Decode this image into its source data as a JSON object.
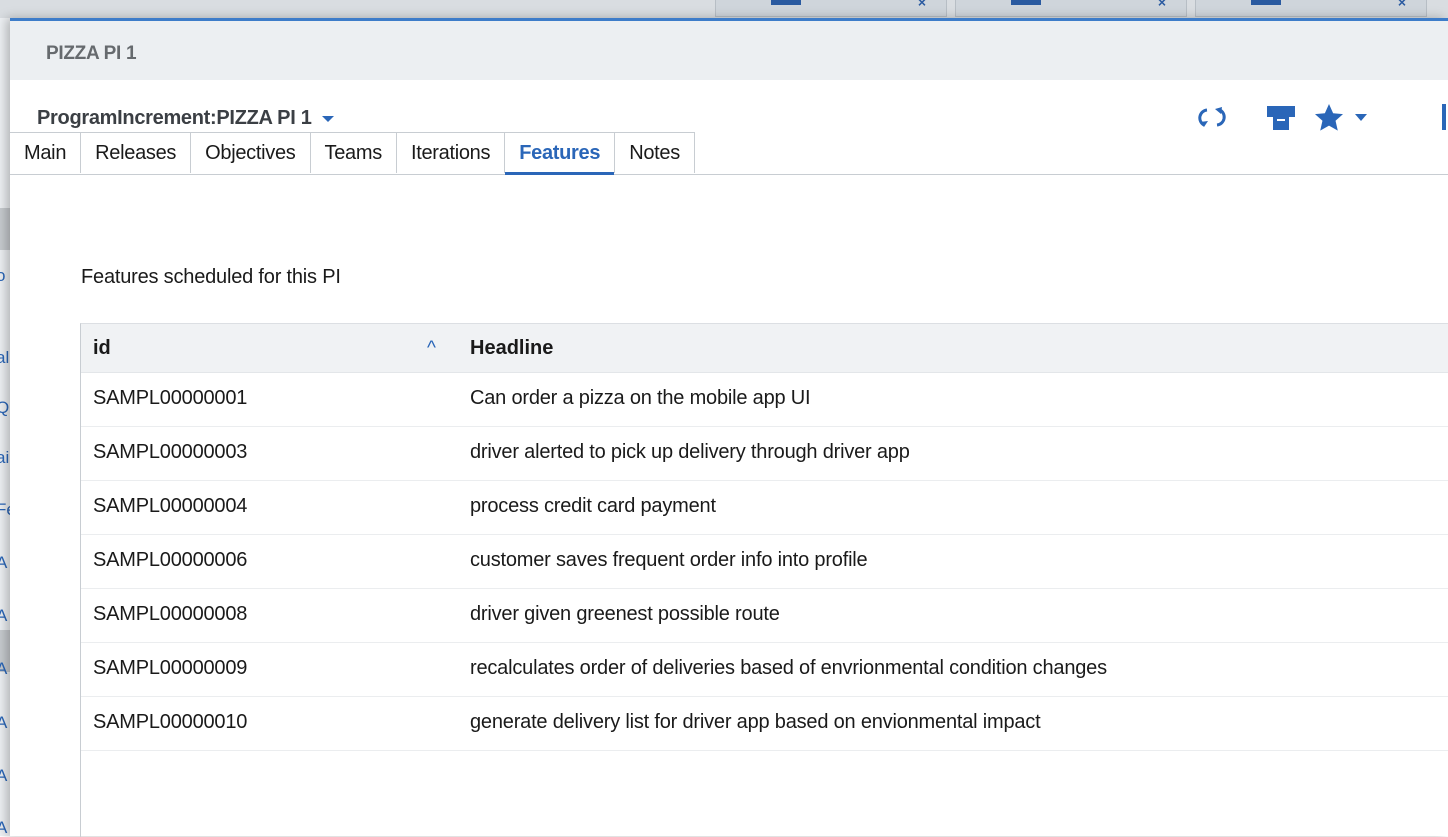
{
  "window": {
    "title": "PIZZA PI 1"
  },
  "header": {
    "record_title": "ProgramIncrement:PIZZA PI 1"
  },
  "toolbar": {
    "icons": [
      "refresh-icon",
      "print-icon",
      "star-icon",
      "chevron-down-icon"
    ]
  },
  "tabs": [
    {
      "label": "Main",
      "active": false
    },
    {
      "label": "Releases",
      "active": false
    },
    {
      "label": "Objectives",
      "active": false
    },
    {
      "label": "Teams",
      "active": false
    },
    {
      "label": "Iterations",
      "active": false
    },
    {
      "label": "Features",
      "active": true
    },
    {
      "label": "Notes",
      "active": false
    }
  ],
  "features": {
    "label": "Features scheduled for this PI",
    "columns": {
      "id": "id",
      "headline": "Headline"
    },
    "rows": [
      {
        "id": "SAMPL00000001",
        "headline": "Can order a pizza on the mobile app UI"
      },
      {
        "id": "SAMPL00000003",
        "headline": "driver alerted to pick up delivery through driver app"
      },
      {
        "id": "SAMPL00000004",
        "headline": "process credit card payment"
      },
      {
        "id": "SAMPL00000006",
        "headline": "customer saves frequent order info into profile"
      },
      {
        "id": "SAMPL00000008",
        "headline": "driver given greenest possible route"
      },
      {
        "id": "SAMPL00000009",
        "headline": "recalculates order of deliveries based of envrionmental condition changes"
      },
      {
        "id": "SAMPL00000010",
        "headline": "generate delivery list for driver app based on envionmental impact"
      }
    ]
  },
  "background_sidebar": {
    "glyphs": [
      "o",
      "al",
      "Q",
      "ai",
      "Fe",
      "A",
      "A",
      "A",
      "A",
      "A",
      "A"
    ]
  },
  "colors": {
    "accent": "#2a66b8",
    "title_bar": "#eceff2",
    "header_row": "#f0f2f4"
  }
}
